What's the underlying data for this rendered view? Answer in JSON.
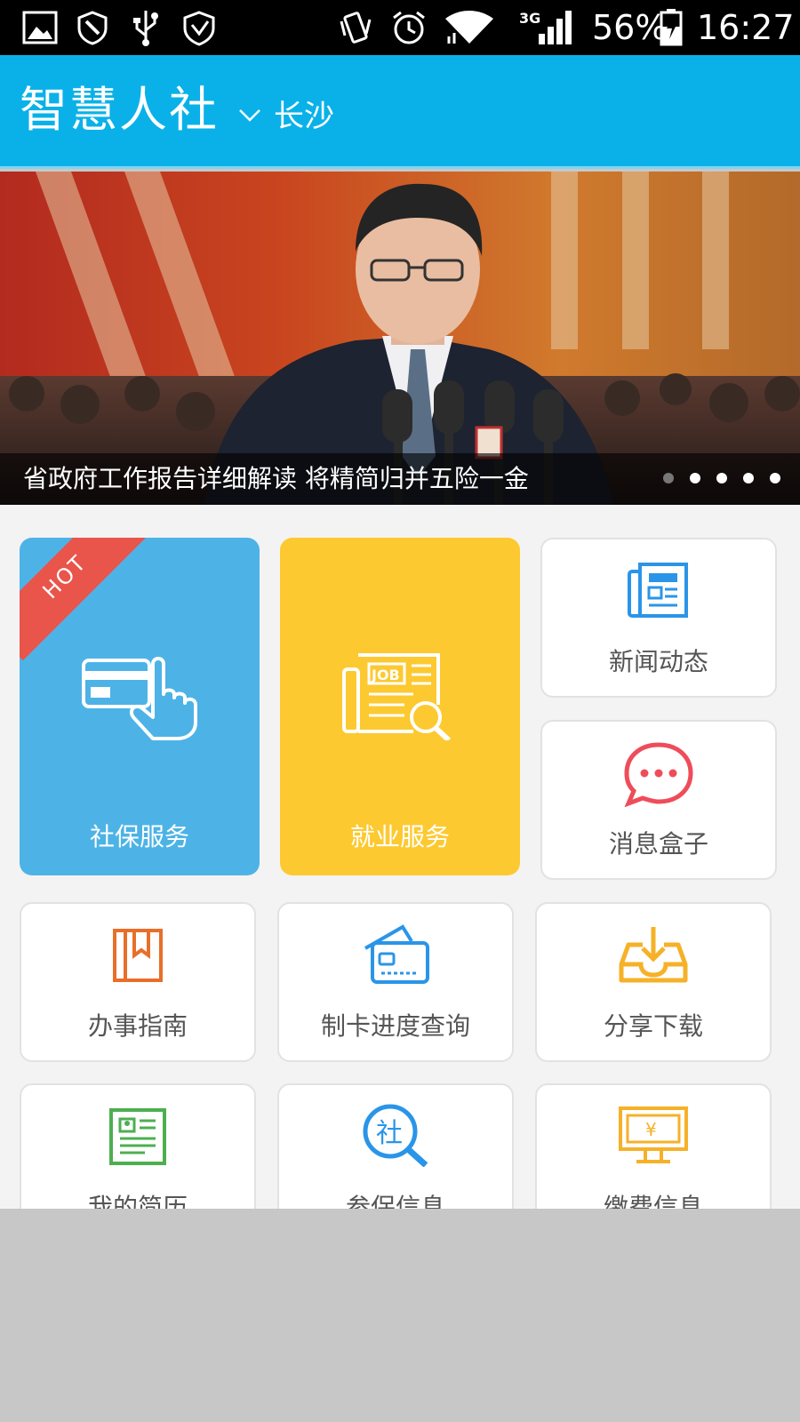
{
  "status_bar": {
    "battery": "56%",
    "time": "16:27",
    "network": "3G"
  },
  "header": {
    "title": "智慧人社",
    "city": "长沙"
  },
  "banner": {
    "caption": "省政府工作报告详细解读 将精简归并五险一金",
    "dots_total": 5,
    "active_dot": 2
  },
  "tiles": {
    "social_security": {
      "label": "社保服务",
      "badge": "HOT",
      "color": "#4db3e6"
    },
    "employment": {
      "label": "就业服务",
      "color": "#fdc930"
    },
    "news": {
      "label": "新闻动态"
    },
    "messages": {
      "label": "消息盒子"
    },
    "guide": {
      "label": "办事指南"
    },
    "card_progress": {
      "label": "制卡进度查询"
    },
    "share_download": {
      "label": "分享下载"
    },
    "my_resume": {
      "label": "我的简历"
    },
    "insurance_info": {
      "label": "参保信息"
    },
    "payment_info": {
      "label": "缴费信息"
    }
  }
}
